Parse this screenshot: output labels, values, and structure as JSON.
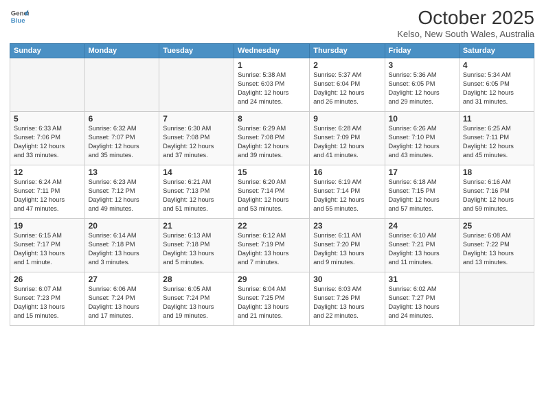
{
  "header": {
    "logo_line1": "General",
    "logo_line2": "Blue",
    "month": "October 2025",
    "location": "Kelso, New South Wales, Australia"
  },
  "days_of_week": [
    "Sunday",
    "Monday",
    "Tuesday",
    "Wednesday",
    "Thursday",
    "Friday",
    "Saturday"
  ],
  "weeks": [
    [
      {
        "day": "",
        "info": ""
      },
      {
        "day": "",
        "info": ""
      },
      {
        "day": "",
        "info": ""
      },
      {
        "day": "1",
        "info": "Sunrise: 5:38 AM\nSunset: 6:03 PM\nDaylight: 12 hours\nand 24 minutes."
      },
      {
        "day": "2",
        "info": "Sunrise: 5:37 AM\nSunset: 6:04 PM\nDaylight: 12 hours\nand 26 minutes."
      },
      {
        "day": "3",
        "info": "Sunrise: 5:36 AM\nSunset: 6:05 PM\nDaylight: 12 hours\nand 29 minutes."
      },
      {
        "day": "4",
        "info": "Sunrise: 5:34 AM\nSunset: 6:05 PM\nDaylight: 12 hours\nand 31 minutes."
      }
    ],
    [
      {
        "day": "5",
        "info": "Sunrise: 6:33 AM\nSunset: 7:06 PM\nDaylight: 12 hours\nand 33 minutes."
      },
      {
        "day": "6",
        "info": "Sunrise: 6:32 AM\nSunset: 7:07 PM\nDaylight: 12 hours\nand 35 minutes."
      },
      {
        "day": "7",
        "info": "Sunrise: 6:30 AM\nSunset: 7:08 PM\nDaylight: 12 hours\nand 37 minutes."
      },
      {
        "day": "8",
        "info": "Sunrise: 6:29 AM\nSunset: 7:08 PM\nDaylight: 12 hours\nand 39 minutes."
      },
      {
        "day": "9",
        "info": "Sunrise: 6:28 AM\nSunset: 7:09 PM\nDaylight: 12 hours\nand 41 minutes."
      },
      {
        "day": "10",
        "info": "Sunrise: 6:26 AM\nSunset: 7:10 PM\nDaylight: 12 hours\nand 43 minutes."
      },
      {
        "day": "11",
        "info": "Sunrise: 6:25 AM\nSunset: 7:11 PM\nDaylight: 12 hours\nand 45 minutes."
      }
    ],
    [
      {
        "day": "12",
        "info": "Sunrise: 6:24 AM\nSunset: 7:11 PM\nDaylight: 12 hours\nand 47 minutes."
      },
      {
        "day": "13",
        "info": "Sunrise: 6:23 AM\nSunset: 7:12 PM\nDaylight: 12 hours\nand 49 minutes."
      },
      {
        "day": "14",
        "info": "Sunrise: 6:21 AM\nSunset: 7:13 PM\nDaylight: 12 hours\nand 51 minutes."
      },
      {
        "day": "15",
        "info": "Sunrise: 6:20 AM\nSunset: 7:14 PM\nDaylight: 12 hours\nand 53 minutes."
      },
      {
        "day": "16",
        "info": "Sunrise: 6:19 AM\nSunset: 7:14 PM\nDaylight: 12 hours\nand 55 minutes."
      },
      {
        "day": "17",
        "info": "Sunrise: 6:18 AM\nSunset: 7:15 PM\nDaylight: 12 hours\nand 57 minutes."
      },
      {
        "day": "18",
        "info": "Sunrise: 6:16 AM\nSunset: 7:16 PM\nDaylight: 12 hours\nand 59 minutes."
      }
    ],
    [
      {
        "day": "19",
        "info": "Sunrise: 6:15 AM\nSunset: 7:17 PM\nDaylight: 13 hours\nand 1 minute."
      },
      {
        "day": "20",
        "info": "Sunrise: 6:14 AM\nSunset: 7:18 PM\nDaylight: 13 hours\nand 3 minutes."
      },
      {
        "day": "21",
        "info": "Sunrise: 6:13 AM\nSunset: 7:18 PM\nDaylight: 13 hours\nand 5 minutes."
      },
      {
        "day": "22",
        "info": "Sunrise: 6:12 AM\nSunset: 7:19 PM\nDaylight: 13 hours\nand 7 minutes."
      },
      {
        "day": "23",
        "info": "Sunrise: 6:11 AM\nSunset: 7:20 PM\nDaylight: 13 hours\nand 9 minutes."
      },
      {
        "day": "24",
        "info": "Sunrise: 6:10 AM\nSunset: 7:21 PM\nDaylight: 13 hours\nand 11 minutes."
      },
      {
        "day": "25",
        "info": "Sunrise: 6:08 AM\nSunset: 7:22 PM\nDaylight: 13 hours\nand 13 minutes."
      }
    ],
    [
      {
        "day": "26",
        "info": "Sunrise: 6:07 AM\nSunset: 7:23 PM\nDaylight: 13 hours\nand 15 minutes."
      },
      {
        "day": "27",
        "info": "Sunrise: 6:06 AM\nSunset: 7:24 PM\nDaylight: 13 hours\nand 17 minutes."
      },
      {
        "day": "28",
        "info": "Sunrise: 6:05 AM\nSunset: 7:24 PM\nDaylight: 13 hours\nand 19 minutes."
      },
      {
        "day": "29",
        "info": "Sunrise: 6:04 AM\nSunset: 7:25 PM\nDaylight: 13 hours\nand 21 minutes."
      },
      {
        "day": "30",
        "info": "Sunrise: 6:03 AM\nSunset: 7:26 PM\nDaylight: 13 hours\nand 22 minutes."
      },
      {
        "day": "31",
        "info": "Sunrise: 6:02 AM\nSunset: 7:27 PM\nDaylight: 13 hours\nand 24 minutes."
      },
      {
        "day": "",
        "info": ""
      }
    ]
  ]
}
